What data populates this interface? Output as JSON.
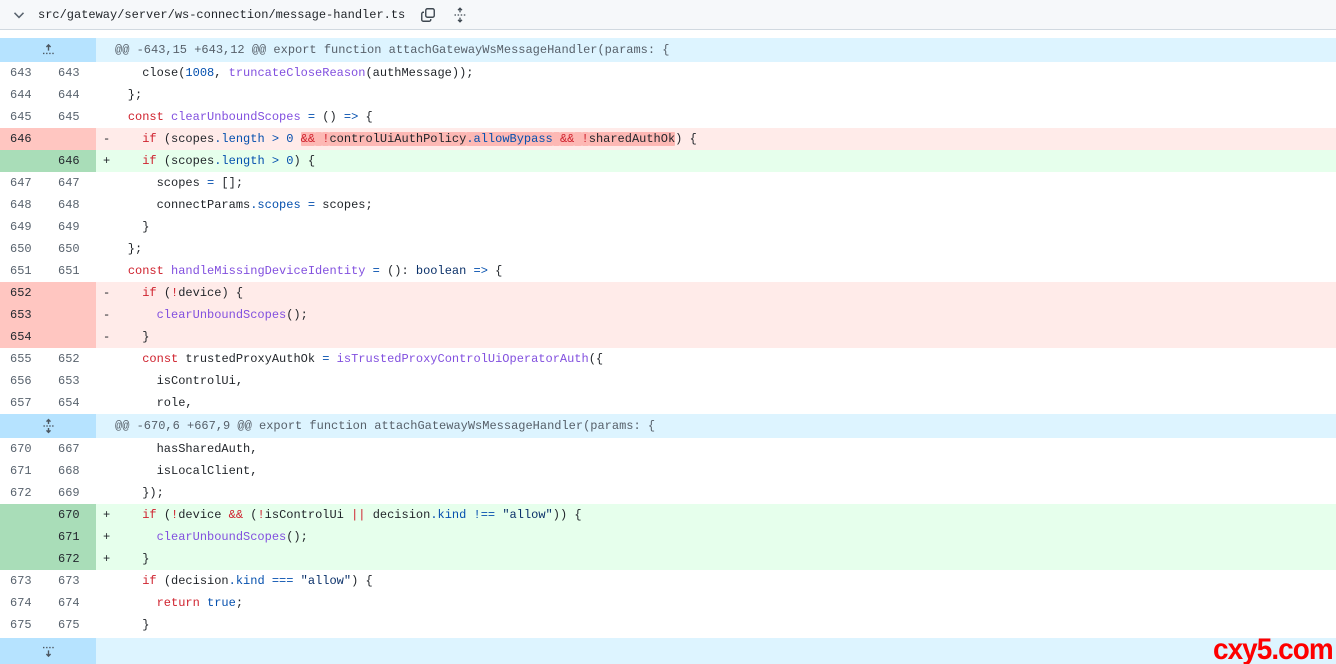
{
  "file_header": {
    "path": "src/gateway/server/ws-connection/message-handler.ts",
    "collapse_icon": "chevron-down-icon",
    "copy_icon": "copy-icon",
    "expand_all_icon": "unfold-icon"
  },
  "colors": {
    "header_bg": "#f6f8fa",
    "hunk_gutter_bg": "#b6e3ff",
    "hunk_body_bg": "#ddf4ff",
    "deletion_gutter_bg": "#ffc6c1",
    "deletion_body_bg": "#ffebe9",
    "deletion_word_highlight": "#fdb8b4",
    "addition_gutter_bg": "#a9ddb8",
    "addition_body_bg": "#e6ffec",
    "keyword": "#cf222e",
    "constant": "#0550ae",
    "string": "#0a3069",
    "entity": "#8250df",
    "watermark_red": "#fe0000"
  },
  "watermark": {
    "text": "cxy5.com"
  },
  "diff": {
    "rows": [
      {
        "type": "hunk",
        "icon": "expand-up-icon",
        "text": "@@ -643,15 +643,12 @@ export function attachGatewayWsMessageHandler(params: {"
      },
      {
        "type": "ctx",
        "old": "643",
        "new": "643",
        "tokens": [
          [
            "t",
            "      close("
          ],
          [
            "c",
            "1008"
          ],
          [
            "t",
            ", "
          ],
          [
            "e",
            "truncateCloseReason"
          ],
          [
            "t",
            "(authMessage));"
          ]
        ]
      },
      {
        "type": "ctx",
        "old": "644",
        "new": "644",
        "tokens": [
          [
            "t",
            "    };"
          ]
        ]
      },
      {
        "type": "ctx",
        "old": "645",
        "new": "645",
        "tokens": [
          [
            "t",
            "    "
          ],
          [
            "k",
            "const"
          ],
          [
            "t",
            " "
          ],
          [
            "e",
            "clearUnboundScopes"
          ],
          [
            "t",
            " "
          ],
          [
            "c",
            "="
          ],
          [
            "t",
            " () "
          ],
          [
            "c",
            "=>"
          ],
          [
            "t",
            " {"
          ]
        ]
      },
      {
        "type": "del",
        "old": "646",
        "new": "",
        "tokens": [
          [
            "t",
            "      "
          ],
          [
            "k",
            "if"
          ],
          [
            "t",
            " (scopes"
          ],
          [
            "c",
            ".length"
          ],
          [
            "t",
            " "
          ],
          [
            "c",
            ">"
          ],
          [
            "t",
            " "
          ],
          [
            "c",
            "0"
          ],
          [
            "t",
            " "
          ],
          [
            "k",
            "&&",
            1
          ],
          [
            "t",
            " ",
            1
          ],
          [
            "k",
            "!",
            1
          ],
          [
            "t",
            "controlUiAuthPolicy",
            1
          ],
          [
            "c",
            ".allowBypass",
            1
          ],
          [
            "t",
            " ",
            1
          ],
          [
            "k",
            "&&",
            1
          ],
          [
            "t",
            " ",
            1
          ],
          [
            "k",
            "!",
            1
          ],
          [
            "t",
            "sharedAuthOk",
            1
          ],
          [
            "t",
            ") {"
          ]
        ]
      },
      {
        "type": "add",
        "old": "",
        "new": "646",
        "tokens": [
          [
            "t",
            "      "
          ],
          [
            "k",
            "if"
          ],
          [
            "t",
            " (scopes"
          ],
          [
            "c",
            ".length"
          ],
          [
            "t",
            " "
          ],
          [
            "c",
            ">"
          ],
          [
            "t",
            " "
          ],
          [
            "c",
            "0"
          ],
          [
            "t",
            ") {"
          ]
        ]
      },
      {
        "type": "ctx",
        "old": "647",
        "new": "647",
        "tokens": [
          [
            "t",
            "        scopes "
          ],
          [
            "c",
            "="
          ],
          [
            "t",
            " [];"
          ]
        ]
      },
      {
        "type": "ctx",
        "old": "648",
        "new": "648",
        "tokens": [
          [
            "t",
            "        connectParams"
          ],
          [
            "c",
            ".scopes"
          ],
          [
            "t",
            " "
          ],
          [
            "c",
            "="
          ],
          [
            "t",
            " scopes;"
          ]
        ]
      },
      {
        "type": "ctx",
        "old": "649",
        "new": "649",
        "tokens": [
          [
            "t",
            "      }"
          ]
        ]
      },
      {
        "type": "ctx",
        "old": "650",
        "new": "650",
        "tokens": [
          [
            "t",
            "    };"
          ]
        ]
      },
      {
        "type": "ctx",
        "old": "651",
        "new": "651",
        "tokens": [
          [
            "t",
            "    "
          ],
          [
            "k",
            "const"
          ],
          [
            "t",
            " "
          ],
          [
            "e",
            "handleMissingDeviceIdentity"
          ],
          [
            "t",
            " "
          ],
          [
            "c",
            "="
          ],
          [
            "t",
            " (): "
          ],
          [
            "s",
            "boolean"
          ],
          [
            "t",
            " "
          ],
          [
            "c",
            "=>"
          ],
          [
            "t",
            " {"
          ]
        ]
      },
      {
        "type": "del",
        "old": "652",
        "new": "",
        "tokens": [
          [
            "t",
            "      "
          ],
          [
            "k",
            "if"
          ],
          [
            "t",
            " ("
          ],
          [
            "k",
            "!"
          ],
          [
            "t",
            "device) {"
          ]
        ]
      },
      {
        "type": "del",
        "old": "653",
        "new": "",
        "tokens": [
          [
            "t",
            "        "
          ],
          [
            "e",
            "clearUnboundScopes"
          ],
          [
            "t",
            "();"
          ]
        ]
      },
      {
        "type": "del",
        "old": "654",
        "new": "",
        "tokens": [
          [
            "t",
            "      }"
          ]
        ]
      },
      {
        "type": "ctx",
        "old": "655",
        "new": "652",
        "tokens": [
          [
            "t",
            "      "
          ],
          [
            "k",
            "const"
          ],
          [
            "t",
            " trustedProxyAuthOk "
          ],
          [
            "c",
            "="
          ],
          [
            "t",
            " "
          ],
          [
            "e",
            "isTrustedProxyControlUiOperatorAuth"
          ],
          [
            "t",
            "({"
          ]
        ]
      },
      {
        "type": "ctx",
        "old": "656",
        "new": "653",
        "tokens": [
          [
            "t",
            "        isControlUi,"
          ]
        ]
      },
      {
        "type": "ctx",
        "old": "657",
        "new": "654",
        "tokens": [
          [
            "t",
            "        role,"
          ]
        ]
      },
      {
        "type": "hunk",
        "icon": "expand-both-icon",
        "text": "@@ -670,6 +667,9 @@ export function attachGatewayWsMessageHandler(params: {"
      },
      {
        "type": "ctx",
        "old": "670",
        "new": "667",
        "tokens": [
          [
            "t",
            "        hasSharedAuth,"
          ]
        ]
      },
      {
        "type": "ctx",
        "old": "671",
        "new": "668",
        "tokens": [
          [
            "t",
            "        isLocalClient,"
          ]
        ]
      },
      {
        "type": "ctx",
        "old": "672",
        "new": "669",
        "tokens": [
          [
            "t",
            "      });"
          ]
        ]
      },
      {
        "type": "add",
        "old": "",
        "new": "670",
        "tokens": [
          [
            "t",
            "      "
          ],
          [
            "k",
            "if"
          ],
          [
            "t",
            " ("
          ],
          [
            "k",
            "!"
          ],
          [
            "t",
            "device "
          ],
          [
            "k",
            "&&"
          ],
          [
            "t",
            " ("
          ],
          [
            "k",
            "!"
          ],
          [
            "t",
            "isControlUi "
          ],
          [
            "k",
            "||"
          ],
          [
            "t",
            " decision"
          ],
          [
            "c",
            ".kind"
          ],
          [
            "t",
            " "
          ],
          [
            "c",
            "!=="
          ],
          [
            "t",
            " "
          ],
          [
            "s",
            "\"allow\""
          ],
          [
            "t",
            ")) {"
          ]
        ]
      },
      {
        "type": "add",
        "old": "",
        "new": "671",
        "tokens": [
          [
            "t",
            "        "
          ],
          [
            "e",
            "clearUnboundScopes"
          ],
          [
            "t",
            "();"
          ]
        ]
      },
      {
        "type": "add",
        "old": "",
        "new": "672",
        "tokens": [
          [
            "t",
            "      }"
          ]
        ]
      },
      {
        "type": "ctx",
        "old": "673",
        "new": "673",
        "tokens": [
          [
            "t",
            "      "
          ],
          [
            "k",
            "if"
          ],
          [
            "t",
            " (decision"
          ],
          [
            "c",
            ".kind"
          ],
          [
            "t",
            " "
          ],
          [
            "c",
            "==="
          ],
          [
            "t",
            " "
          ],
          [
            "s",
            "\"allow\""
          ],
          [
            "t",
            ") {"
          ]
        ]
      },
      {
        "type": "ctx",
        "old": "674",
        "new": "674",
        "tokens": [
          [
            "t",
            "        "
          ],
          [
            "k",
            "return"
          ],
          [
            "t",
            " "
          ],
          [
            "c",
            "true"
          ],
          [
            "t",
            ";"
          ]
        ]
      },
      {
        "type": "ctx",
        "old": "675",
        "new": "675",
        "tokens": [
          [
            "t",
            "      }"
          ]
        ]
      },
      {
        "type": "expand",
        "icon": "expand-down-icon",
        "text": ""
      }
    ]
  }
}
